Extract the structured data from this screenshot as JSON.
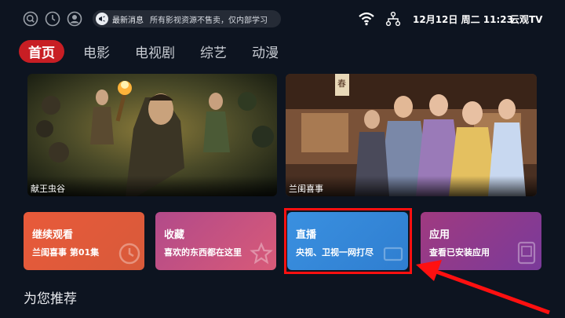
{
  "topbar": {
    "icons": [
      "search-icon",
      "history-icon",
      "user-icon"
    ],
    "notice": {
      "tag": "最新消息",
      "text": "所有影视资源不售卖，仅内部学习"
    },
    "status_icons": [
      "wifi-icon",
      "network-icon"
    ],
    "datetime": "12月12日 周二 11:23",
    "brand": "云观TV"
  },
  "tabs": [
    {
      "label": "首页",
      "active": true
    },
    {
      "label": "电影",
      "active": false
    },
    {
      "label": "电视剧",
      "active": false
    },
    {
      "label": "综艺",
      "active": false
    },
    {
      "label": "动漫",
      "active": false
    }
  ],
  "banners": [
    {
      "title": "献王虫谷"
    },
    {
      "title": "兰闺喜事",
      "sign_text": "春"
    }
  ],
  "cards": [
    {
      "title": "继续观看",
      "subtitle": "兰闺喜事 第01集",
      "icon": "history-icon",
      "color": "#e0583a"
    },
    {
      "title": "收藏",
      "subtitle": "喜欢的东西都在这里",
      "icon": "star-icon",
      "color": "#c04a7c"
    },
    {
      "title": "直播",
      "subtitle": "央视、卫视一网打尽",
      "icon": "tv-icon",
      "color": "#2f88d8"
    },
    {
      "title": "应用",
      "subtitle": "查看已安装应用",
      "icon": "tablet-icon",
      "color": "#9a3f8e"
    }
  ],
  "section": {
    "title": "为您推荐"
  },
  "annotation": {
    "highlight_color": "#ff1010"
  }
}
